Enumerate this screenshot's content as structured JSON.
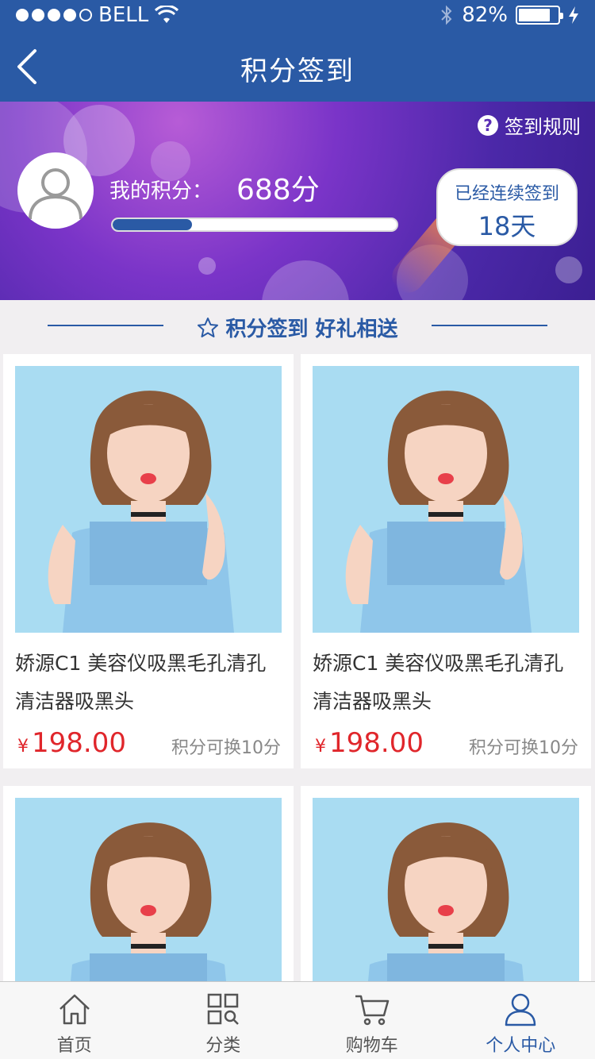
{
  "status_bar": {
    "carrier": "BELL",
    "battery": "82%"
  },
  "nav": {
    "title": "积分签到"
  },
  "banner": {
    "rules_label": "签到规则",
    "points_label": "我的积分：",
    "points_value": "688分",
    "progress_fraction": 0.28,
    "signed_label": "已经连续签到",
    "signed_days": "18天"
  },
  "section": {
    "title": "积分签到 好礼相送"
  },
  "products": [
    {
      "name": "娇源C1 美容仪吸黑毛孔清孔清洁器吸黑头",
      "currency": "¥",
      "price": "198.00",
      "exchange": "积分可换10分"
    },
    {
      "name": "娇源C1 美容仪吸黑毛孔清孔清洁器吸黑头",
      "currency": "¥",
      "price": "198.00",
      "exchange": "积分可换10分"
    },
    {
      "name": "",
      "currency": "",
      "price": "",
      "exchange": ""
    },
    {
      "name": "",
      "currency": "",
      "price": "",
      "exchange": ""
    }
  ],
  "tabs": [
    {
      "label": "首页",
      "icon": "home-icon"
    },
    {
      "label": "分类",
      "icon": "category-icon"
    },
    {
      "label": "购物车",
      "icon": "cart-icon"
    },
    {
      "label": "个人中心",
      "icon": "user-icon"
    }
  ],
  "colors": {
    "primary": "#2a5aa5",
    "price": "#e0262b",
    "banner": "#6a30c0"
  }
}
